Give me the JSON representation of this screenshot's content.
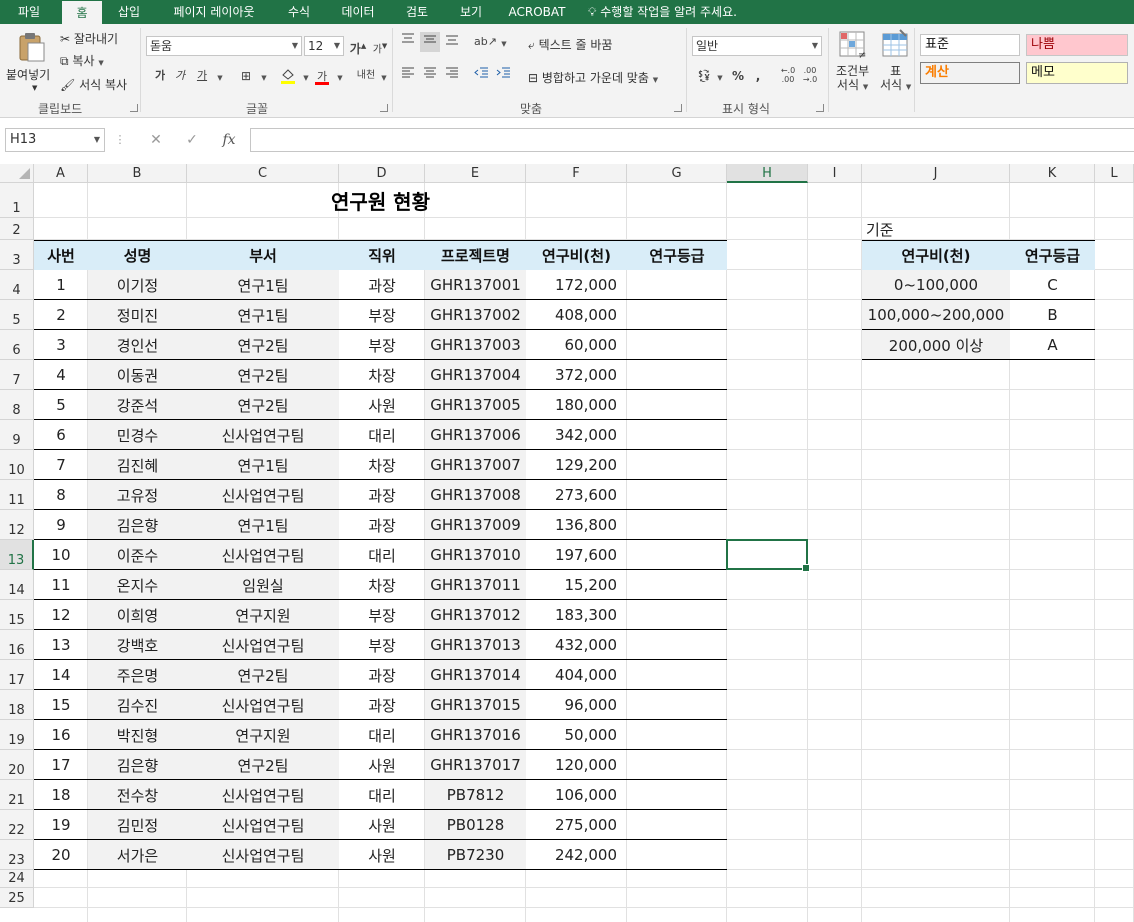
{
  "tabs": [
    "파일",
    "홈",
    "삽입",
    "페이지 레이아웃",
    "수식",
    "데이터",
    "검토",
    "보기",
    "ACROBAT"
  ],
  "tell_me": "수행할 작업을 알려 주세요.",
  "ribbon": {
    "paste": "붙여넣기",
    "cut": "잘라내기",
    "copy": "복사",
    "format_painter": "서식 복사",
    "clipboard_label": "클립보드",
    "font_name": "돋움",
    "font_size": "12",
    "font_label": "글꼴",
    "wrap_text": "텍스트 줄 바꿈",
    "merge_center": "병합하고 가운데 맞춤",
    "alignment_label": "맞춤",
    "number_format": "일반",
    "number_label": "표시 형식",
    "cond_format": [
      "조건부",
      "서식"
    ],
    "table_format": [
      "표",
      "서식"
    ],
    "styles": {
      "normal": "표준",
      "bad": "나쁨",
      "calc": "계산",
      "memo": "메모"
    },
    "colors": {
      "bad_bg": "#ffc7ce",
      "bad_fg": "#9c0006",
      "calc_bg": "#f2f2f2",
      "calc_fg": "#fa7d00",
      "memo_bg": "#ffffcc",
      "accent": "#217346"
    }
  },
  "formula_bar": {
    "name_box": "H13",
    "formula": ""
  },
  "sheet": {
    "columns": [
      "A",
      "B",
      "C",
      "D",
      "E",
      "F",
      "G",
      "H",
      "I",
      "J",
      "K",
      "L"
    ],
    "rows": [
      "1",
      "2",
      "3",
      "4",
      "5",
      "6",
      "7",
      "8",
      "9",
      "10",
      "11",
      "12",
      "13",
      "14",
      "15",
      "16",
      "17",
      "18",
      "19",
      "20",
      "21",
      "22",
      "23",
      "24",
      "25"
    ],
    "selected_col": "H",
    "selected_row": "13",
    "title": "연구원 현황",
    "headers": [
      "사번",
      "성명",
      "부서",
      "직위",
      "프로젝트명",
      "연구비(천)",
      "연구등급"
    ],
    "records": [
      [
        "1",
        "이기정",
        "연구1팀",
        "과장",
        "GHR137001",
        "172,000",
        ""
      ],
      [
        "2",
        "정미진",
        "연구1팀",
        "부장",
        "GHR137002",
        "408,000",
        ""
      ],
      [
        "3",
        "경인선",
        "연구2팀",
        "부장",
        "GHR137003",
        "60,000",
        ""
      ],
      [
        "4",
        "이동권",
        "연구2팀",
        "차장",
        "GHR137004",
        "372,000",
        ""
      ],
      [
        "5",
        "강준석",
        "연구2팀",
        "사원",
        "GHR137005",
        "180,000",
        ""
      ],
      [
        "6",
        "민경수",
        "신사업연구팀",
        "대리",
        "GHR137006",
        "342,000",
        ""
      ],
      [
        "7",
        "김진혜",
        "연구1팀",
        "차장",
        "GHR137007",
        "129,200",
        ""
      ],
      [
        "8",
        "고유정",
        "신사업연구팀",
        "과장",
        "GHR137008",
        "273,600",
        ""
      ],
      [
        "9",
        "김은향",
        "연구1팀",
        "과장",
        "GHR137009",
        "136,800",
        ""
      ],
      [
        "10",
        "이준수",
        "신사업연구팀",
        "대리",
        "GHR137010",
        "197,600",
        ""
      ],
      [
        "11",
        "온지수",
        "임원실",
        "차장",
        "GHR137011",
        "15,200",
        ""
      ],
      [
        "12",
        "이희영",
        "연구지원",
        "부장",
        "GHR137012",
        "183,300",
        ""
      ],
      [
        "13",
        "강백호",
        "신사업연구팀",
        "부장",
        "GHR137013",
        "432,000",
        ""
      ],
      [
        "14",
        "주은명",
        "연구2팀",
        "과장",
        "GHR137014",
        "404,000",
        ""
      ],
      [
        "15",
        "김수진",
        "신사업연구팀",
        "과장",
        "GHR137015",
        "96,000",
        ""
      ],
      [
        "16",
        "박진형",
        "연구지원",
        "대리",
        "GHR137016",
        "50,000",
        ""
      ],
      [
        "17",
        "김은향",
        "연구2팀",
        "사원",
        "GHR137017",
        "120,000",
        ""
      ],
      [
        "18",
        "전수창",
        "신사업연구팀",
        "대리",
        "PB7812",
        "106,000",
        ""
      ],
      [
        "19",
        "김민정",
        "신사업연구팀",
        "사원",
        "PB0128",
        "275,000",
        ""
      ],
      [
        "20",
        "서가은",
        "신사업연구팀",
        "사원",
        "PB7230",
        "242,000",
        ""
      ]
    ],
    "criteria": {
      "label": "기준",
      "headers": [
        "연구비(천)",
        "연구등급"
      ],
      "rows": [
        [
          "0~100,000",
          "C"
        ],
        [
          "100,000~200,000",
          "B"
        ],
        [
          "200,000 이상",
          "A"
        ]
      ]
    }
  }
}
